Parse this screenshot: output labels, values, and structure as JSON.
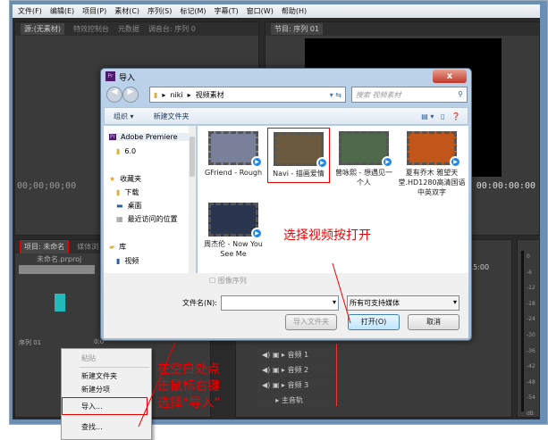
{
  "menu": [
    "文件(F)",
    "编辑(E)",
    "项目(P)",
    "素材(C)",
    "序列(S)",
    "标记(M)",
    "字幕(T)",
    "窗口(W)",
    "帮助(H)"
  ],
  "source_panel": {
    "tabs": [
      "源:(无素材)",
      "特效控制台",
      "元数据",
      "调音台: 序列 0"
    ],
    "timecode": "00;00;00;00"
  },
  "program_panel": {
    "tab": "节目: 序列 01",
    "timecode": "00:00:00:00"
  },
  "project_panel": {
    "tabs": [
      "项目: 未命名",
      "媒体浏"
    ],
    "file": "未命名.prproj",
    "item": "序列 01",
    "item_dur": "0:0"
  },
  "timeline": {
    "ruler": "15:00",
    "tracks": [
      "音频 1",
      "音频 2",
      "音频 3",
      "主音轨"
    ]
  },
  "meter": [
    "0",
    "-6",
    "-12",
    "-18",
    "-24",
    "-30",
    "-36",
    "-42",
    "-48",
    "-54",
    "dB"
  ],
  "dialog": {
    "title": "导入",
    "close": "x",
    "path": [
      "niki",
      "视频素材"
    ],
    "search_placeholder": "搜索 视频素材",
    "toolbar": {
      "organize": "组织 ▾",
      "new_folder": "新建文件夹"
    },
    "nav": [
      "Adobe Premiere",
      "6.0",
      "收藏夹",
      "下载",
      "桌面",
      "最近访问的位置",
      "库",
      "视频"
    ],
    "files": [
      {
        "name": "GFriend - Rough",
        "color": "#7a7f9a"
      },
      {
        "name": "Navi - 描画爱情",
        "color": "#6b5a3e"
      },
      {
        "name": "曾咏熙 - 想遇见一个人",
        "color": "#4e6a4a"
      },
      {
        "name": "夏有乔木 雅望天堂.HD1280高清国语中英双字",
        "color": "#c2561a"
      },
      {
        "name": "周杰伦 - Now You See Me",
        "color": "#2a3550"
      }
    ],
    "image_sequence": "图像序列",
    "filename_label": "文件名(N):",
    "filename_value": "",
    "filter": "所有可支持媒体",
    "import_folder": "导入文件夹",
    "open": "打开(O)",
    "cancel": "取消"
  },
  "context_menu": [
    "粘贴",
    "新建文件夹",
    "新建分项",
    "导入...",
    "查找..."
  ],
  "annotations": {
    "select": "选择视频按打开",
    "rightclick": [
      "在空白处点",
      "击鼠标右键",
      "选择“导入”"
    ]
  }
}
